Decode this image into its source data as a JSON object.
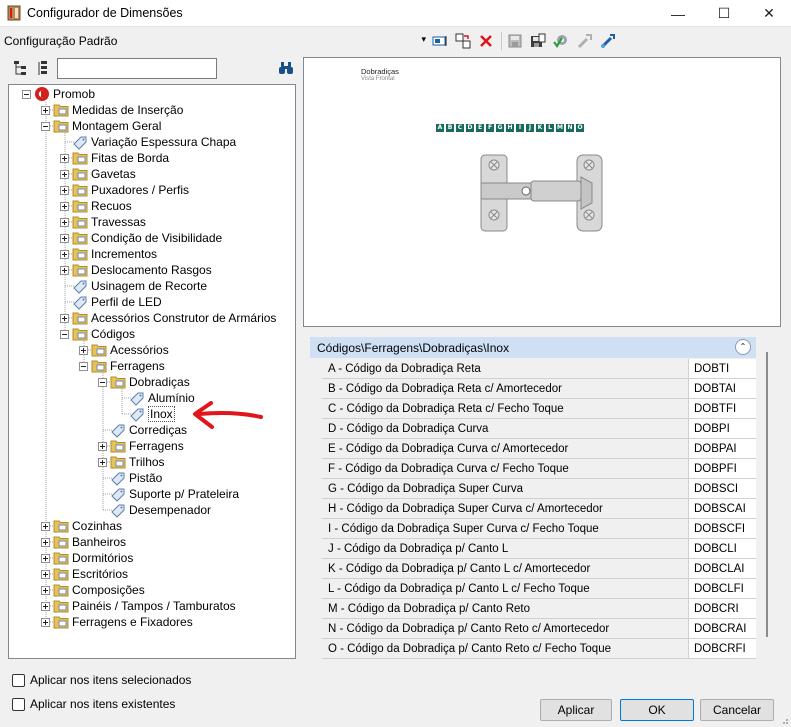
{
  "window": {
    "title": "Configurador de Dimensões",
    "minimize": "—",
    "maximize": "☐",
    "close": "✕"
  },
  "toolbar": {
    "config_value": "Configuração Padrão",
    "dropdown_glyph": "▾"
  },
  "tree_search": {
    "value": "",
    "placeholder": ""
  },
  "tree": {
    "root": "Promob",
    "l1": {
      "medidas": "Medidas de Inserção",
      "montagem": "Montagem Geral",
      "cozinhas": "Cozinhas",
      "banheiros": "Banheiros",
      "dormitorios": "Dormitórios",
      "escritorios": "Escritórios",
      "composicoes": "Composições",
      "paineis": "Painéis / Tampos / Tamburatos",
      "ferragens_fix": "Ferragens e Fixadores"
    },
    "montagem": {
      "variacao": "Variação Espessura Chapa",
      "fitas": "Fitas de Borda",
      "gavetas": "Gavetas",
      "puxadores": "Puxadores / Perfis",
      "recuos": "Recuos",
      "travessas": "Travessas",
      "condicao": "Condição de Visibilidade",
      "incrementos": "Incrementos",
      "deslocamento": "Deslocamento Rasgos",
      "usinagem": "Usinagem de Recorte",
      "perfil_led": "Perfil de LED",
      "acessorios_ca": "Acessórios Construtor de Armários",
      "codigos": "Códigos"
    },
    "codigos": {
      "acessorios": "Acessórios",
      "ferragens": "Ferragens"
    },
    "ferragens": {
      "dobradicas": "Dobradiças",
      "corredicas": "Corrediças",
      "ferragens": "Ferragens",
      "trilhos": "Trilhos",
      "pistao": "Pistão",
      "suporte": "Suporte p/ Prateleira",
      "desempenador": "Desempenador"
    },
    "dobradicas": {
      "aluminio": "Alumínio",
      "inox": "Inox"
    }
  },
  "preview": {
    "title": "Dobradiças",
    "subtitle": "Vista Frontal",
    "letters": [
      "A",
      "B",
      "C",
      "D",
      "E",
      "F",
      "G",
      "H",
      "I",
      "J",
      "K",
      "L",
      "M",
      "N",
      "O"
    ]
  },
  "grid": {
    "header": "Códigos\\Ferragens\\Dobradiças\\Inox",
    "collapse_glyph": "⌃",
    "rows": [
      {
        "label": "A - Código da Dobradiça Reta",
        "value": "DOBTI"
      },
      {
        "label": "B - Código da Dobradiça Reta c/ Amortecedor",
        "value": "DOBTAI"
      },
      {
        "label": "C - Código da Dobradiça Reta c/ Fecho Toque",
        "value": "DOBTFI"
      },
      {
        "label": "D - Código da Dobradiça Curva",
        "value": "DOBPI"
      },
      {
        "label": "E - Código da Dobradiça Curva c/ Amortecedor",
        "value": "DOBPAI"
      },
      {
        "label": "F - Código da Dobradiça Curva c/ Fecho Toque",
        "value": "DOBPFI"
      },
      {
        "label": "G - Código da Dobradiça Super Curva",
        "value": "DOBSCI"
      },
      {
        "label": "H - Código da Dobradiça Super Curva c/ Amortecedor",
        "value": "DOBSCAI"
      },
      {
        "label": "I - Código da Dobradiça Super Curva c/ Fecho Toque",
        "value": "DOBSCFI"
      },
      {
        "label": "J - Código da Dobradiça p/ Canto L",
        "value": "DOBCLI"
      },
      {
        "label": "K - Código da Dobradiça p/ Canto L c/ Amortecedor",
        "value": "DOBCLAI"
      },
      {
        "label": "L - Código da Dobradiça p/ Canto L c/ Fecho Toque",
        "value": "DOBCLFI"
      },
      {
        "label": "M - Código da Dobradiça p/ Canto Reto",
        "value": "DOBCRI"
      },
      {
        "label": "N - Código da Dobradiça p/ Canto Reto c/ Amortecedor",
        "value": "DOBCRAI"
      },
      {
        "label": "O - Código da Dobradiça p/ Canto Reto c/ Fecho Toque",
        "value": "DOBCRFI"
      }
    ]
  },
  "options": {
    "apply_selected": "Aplicar nos itens selecionados",
    "apply_existing": "Aplicar nos itens existentes"
  },
  "buttons": {
    "apply": "Aplicar",
    "ok": "OK",
    "cancel": "Cancelar"
  },
  "colors": {
    "folder": "#e8c15a",
    "selection_arrow": "#e0161b",
    "grid_header": "#cfe0f5",
    "letter_badge": "#1a6b5c"
  }
}
